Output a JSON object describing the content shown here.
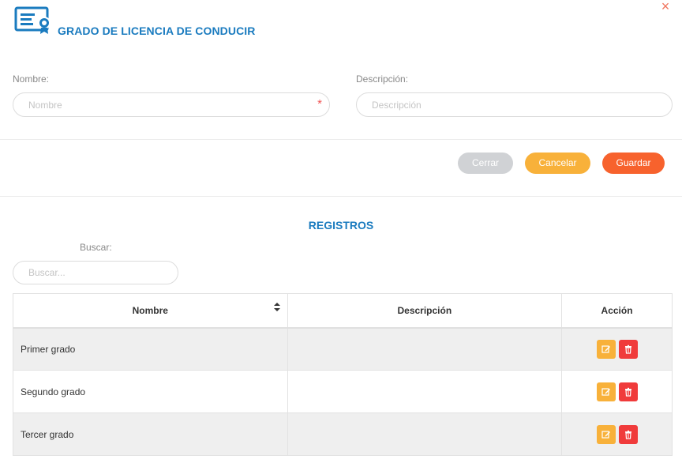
{
  "header": {
    "title": "GRADO DE LICENCIA DE CONDUCIR",
    "close_symbol": "×",
    "icon": "certificate-icon"
  },
  "form": {
    "nombre": {
      "label": "Nombre:",
      "placeholder": "Nombre",
      "value": "",
      "required_mark": "*"
    },
    "descripcion": {
      "label": "Descripción:",
      "placeholder": "Descripción",
      "value": ""
    }
  },
  "buttons": {
    "cerrar": "Cerrar",
    "cancelar": "Cancelar",
    "guardar": "Guardar"
  },
  "registros": {
    "title": "REGISTROS",
    "search": {
      "label": "Buscar:",
      "placeholder": "Buscar...",
      "value": ""
    },
    "table": {
      "headers": [
        "Nombre",
        "Descripción",
        "Acción"
      ],
      "sort_icon": "sort-icon",
      "rows": [
        {
          "nombre": "Primer grado",
          "descripcion": ""
        },
        {
          "nombre": "Segundo grado",
          "descripcion": ""
        },
        {
          "nombre": "Tercer grado",
          "descripcion": ""
        }
      ]
    }
  },
  "colors": {
    "accent": "#1a7bbf",
    "cerrar": "#d0d2d5",
    "cancelar": "#f8b13a",
    "guardar": "#f7622d",
    "delete": "#f03b3b",
    "close": "#f0735c"
  }
}
